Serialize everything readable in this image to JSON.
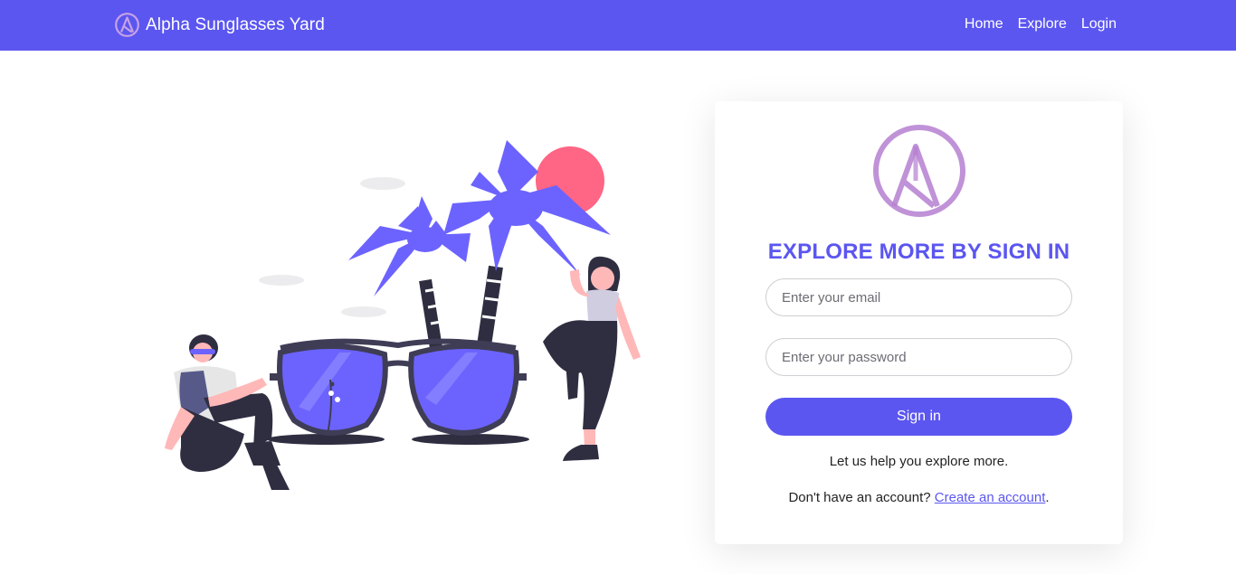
{
  "navbar": {
    "brand_name": "Alpha Sunglasses Yard",
    "links": [
      {
        "label": "Home"
      },
      {
        "label": "Explore"
      },
      {
        "label": "Login"
      }
    ]
  },
  "login": {
    "title": "EXPLORE MORE BY SIGN IN",
    "email_placeholder": "Enter your email",
    "password_placeholder": "Enter your password",
    "submit_label": "Sign in",
    "help_text": "Let us help you explore more.",
    "signup_prompt": "Don't have an account?",
    "signup_link": "Create an account",
    "signup_suffix": "."
  },
  "icons": {
    "brand_logo": "alpha-logo-icon",
    "card_logo": "alpha-logo-icon"
  },
  "colors": {
    "primary": "#5b56f0",
    "sun": "#ff6584",
    "logo": "#b57fd0",
    "dark": "#2f2e41"
  }
}
